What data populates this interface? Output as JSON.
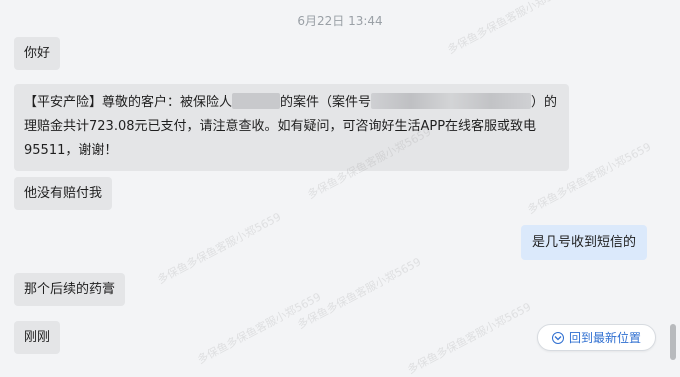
{
  "header": {
    "timestamp": "6月22日 13:44"
  },
  "messages": [
    {
      "side": "in",
      "text": "你好"
    },
    {
      "side": "in",
      "text_part1": "【平安产险】尊敬的客户：被保险人",
      "text_part2": "的案件（案件号",
      "text_part3": "）的理赔金共计723.08元已支付，请注意查收。如有疑问，可咨询好生活APP在线客服或致电95511，谢谢！"
    },
    {
      "side": "in",
      "text": "他没有赔付我"
    },
    {
      "side": "out",
      "text": "是几号收到短信的"
    },
    {
      "side": "in",
      "text": "那个后续的药膏"
    },
    {
      "side": "in",
      "text": "刚刚"
    }
  ],
  "jump_button": {
    "label": "回到最新位置",
    "icon": "chevron-down-icon"
  },
  "watermark": {
    "text": "多保鱼多保鱼客服小郑5659"
  },
  "colors": {
    "incoming_bubble": "#e4e5e7",
    "outgoing_bubble": "#dbe9fb",
    "accent": "#2f6fd1"
  }
}
